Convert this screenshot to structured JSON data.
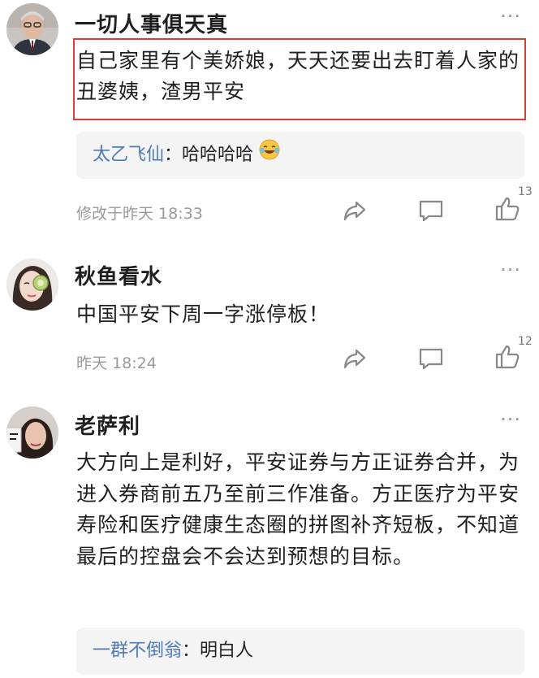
{
  "comments": [
    {
      "author": "一切人事俱天真",
      "text": "自己家里有个美娇娘，天天还要出去盯着人家的丑婆姨，渣男平安",
      "reply": {
        "name": "太乙飞仙",
        "separator": "：",
        "text": "哈哈哈哈"
      },
      "time": "修改于昨天 18:33",
      "likes": "13",
      "more": "···"
    },
    {
      "author": "秋鱼看水",
      "text": "中国平安下周一字涨停板！",
      "time": "昨天 18:24",
      "likes": "12",
      "more": "···"
    },
    {
      "author": "老萨利",
      "text": "大方向上是利好，平安证券与方正证券合并，为进入券商前五乃至前三作准备。方正医疗为平安寿险和医疗健康生态圈的拼图补齐短板，不知道最后的控盘会不会达到预想的目标。",
      "reply": {
        "name": "一群不倒翁",
        "separator": "：",
        "text": "明白人"
      },
      "more": "···"
    }
  ],
  "colors": {
    "reply_name": "#4e7bb8",
    "highlight": "#e23a35",
    "muted": "#9a9a9a"
  },
  "icons": [
    "share-icon",
    "comment-icon",
    "like-icon",
    "laughing-emoji-icon",
    "more-icon"
  ]
}
